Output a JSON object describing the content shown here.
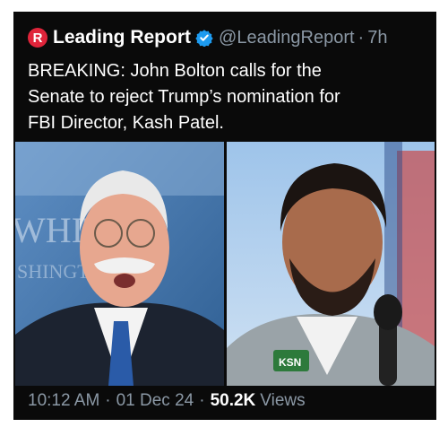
{
  "tweet": {
    "logo_letter": "R",
    "author_name": "Leading Report",
    "handle": "@LeadingReport",
    "separator": "·",
    "time_ago": "7h",
    "text_lines": [
      "BREAKING: John Bolton calls for the",
      "Senate to reject Trump’s nomination for",
      "FBI Director, Kash Patel."
    ],
    "footer": {
      "time": "10:12 AM",
      "date": "01 Dec 24",
      "views_count": "50.2K",
      "views_label": "Views"
    }
  },
  "media": [
    {
      "background_text": "WHIT",
      "background_text2": "SHINGT"
    },
    {
      "badge_text": "KSN"
    }
  ],
  "colors": {
    "card_background": "#0a0a0a",
    "secondary_text": "#8b98a5",
    "verified_blue": "#1d9bf0",
    "logo_red": "#e0243a"
  },
  "icons": [
    "logo-icon",
    "verified-badge-icon"
  ]
}
